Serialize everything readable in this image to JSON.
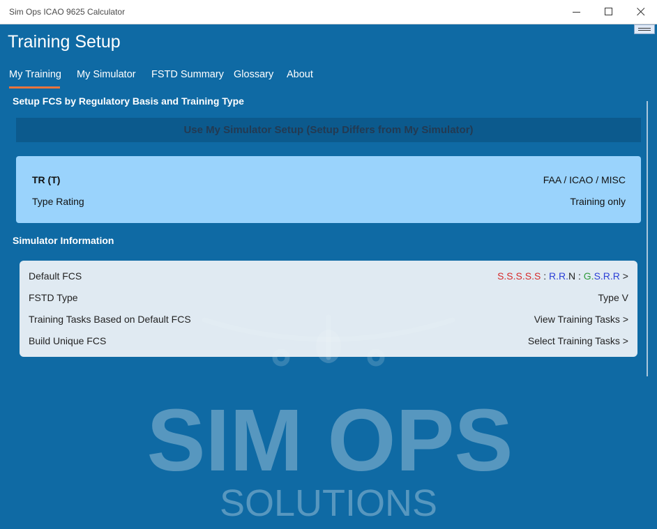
{
  "window": {
    "title": "Sim Ops ICAO 9625 Calculator"
  },
  "page": {
    "title": "Training Setup"
  },
  "tabs": [
    {
      "label": "My Training",
      "active": true
    },
    {
      "label": "My Simulator",
      "active": false
    },
    {
      "label": "FSTD Summary",
      "active": false
    },
    {
      "label": "Glossary",
      "active": false
    },
    {
      "label": "About",
      "active": false
    }
  ],
  "setup": {
    "heading": "Setup FCS by Regulatory Basis and Training Type",
    "use_simulator_button": "Use My Simulator Setup (Setup Differs from My Simulator)"
  },
  "training_card": {
    "code": "TR (T)",
    "regulatory": "FAA / ICAO / MISC",
    "type_label": "Type Rating",
    "scope": "Training only"
  },
  "simulator": {
    "heading": "Simulator Information",
    "rows": [
      {
        "label": "Default FCS"
      },
      {
        "label": "FSTD Type",
        "value": "Type V"
      },
      {
        "label": "Training Tasks Based on Default FCS",
        "value": "View Training Tasks >"
      },
      {
        "label": "Build Unique FCS",
        "value": "Select Training Tasks >"
      }
    ],
    "fcs": {
      "group1": "S.S.S.S.S",
      "sep1": " : ",
      "group2a": "R.R.",
      "group2b": "N",
      "sep2": " : ",
      "group3a": "G.",
      "group3b": "S.R.R",
      "chevron": " >"
    }
  },
  "watermark": {
    "line1": "SIM OPS",
    "line2": "SOLUTIONS"
  },
  "colors": {
    "background": "#0f6aa4",
    "accent": "#e9743c",
    "card_light_blue": "#9ad3fc",
    "fcs_red": "#d62b2b",
    "fcs_blue": "#2b3fd6",
    "fcs_green": "#2f9a3a"
  }
}
